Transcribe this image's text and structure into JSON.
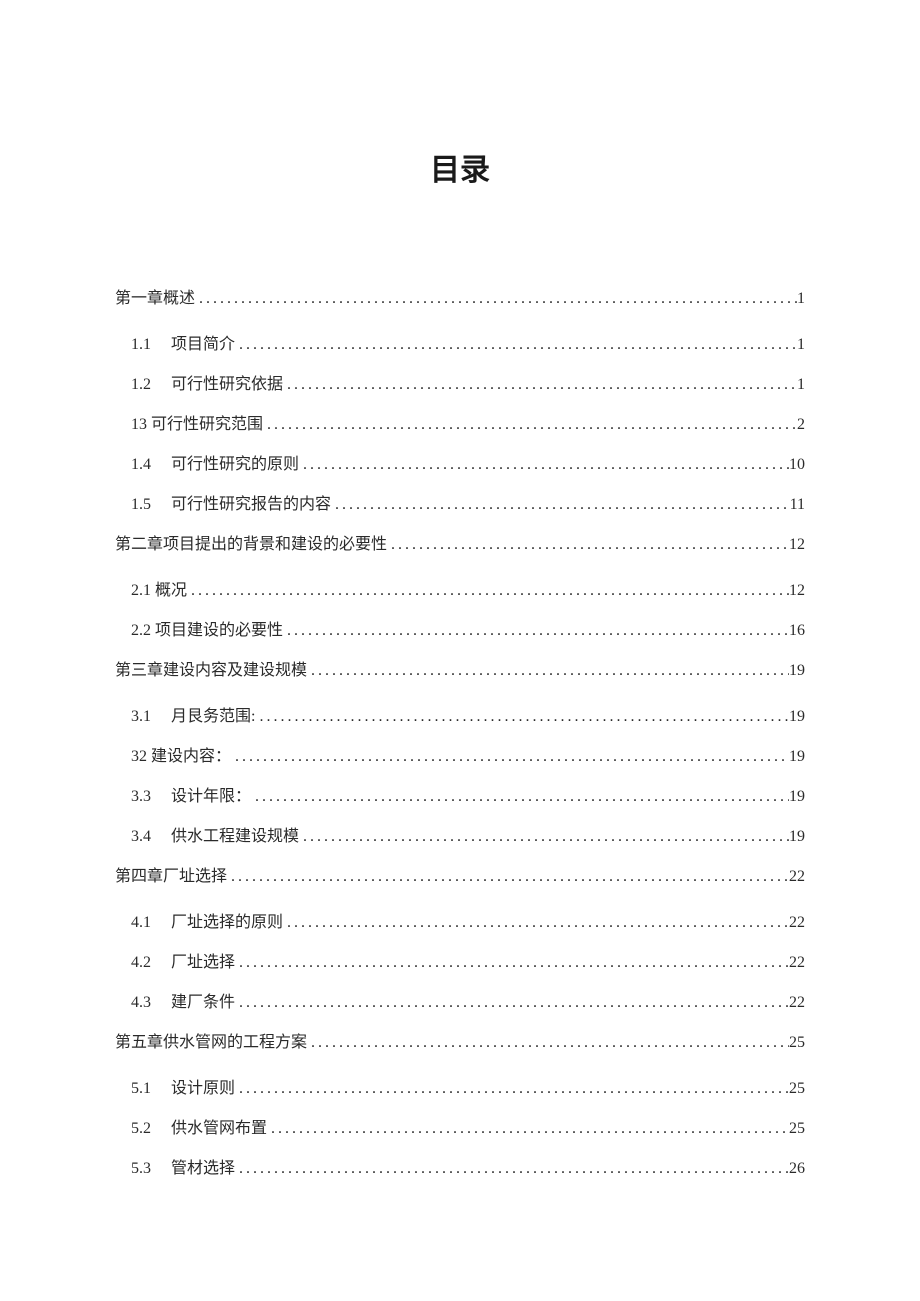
{
  "title": "目录",
  "entries": [
    {
      "indent": 0,
      "num": "",
      "label": "第一章概述",
      "page": "1"
    },
    {
      "indent": 1,
      "num": "1.1",
      "label": "项目简介",
      "page": "1"
    },
    {
      "indent": 1,
      "num": "1.2",
      "label": "可行性研究依据",
      "page": "1"
    },
    {
      "indent": 1,
      "num": "",
      "label": "13 可行性研究范围",
      "page": "2"
    },
    {
      "indent": 1,
      "num": "1.4",
      "label": "可行性研究的原则",
      "page": "10"
    },
    {
      "indent": 1,
      "num": "1.5",
      "label": "可行性研究报告的内容",
      "page": "11"
    },
    {
      "indent": 0,
      "num": "",
      "label": "第二章项目提出的背景和建设的必要性",
      "page": "12"
    },
    {
      "indent": 1,
      "num": "",
      "label": "2.1 概况",
      "page": "12"
    },
    {
      "indent": 1,
      "num": "",
      "label": "2.2 项目建设的必要性",
      "page": "16"
    },
    {
      "indent": 0,
      "num": "",
      "label": "第三章建设内容及建设规模",
      "page": "19"
    },
    {
      "indent": 1,
      "num": "3.1",
      "label": "月艮务范围:",
      "page": "19"
    },
    {
      "indent": 1,
      "num": "",
      "label": "32 建设内容：",
      "page": "19"
    },
    {
      "indent": 1,
      "num": "3.3",
      "label": "设计年限：",
      "page": "19"
    },
    {
      "indent": 1,
      "num": "3.4",
      "label": "供水工程建设规模",
      "page": "19"
    },
    {
      "indent": 0,
      "num": "",
      "label": "第四章厂址选择",
      "page": "22"
    },
    {
      "indent": 1,
      "num": "4.1",
      "label": "厂址选择的原则",
      "page": "22"
    },
    {
      "indent": 1,
      "num": "4.2",
      "label": "厂址选择",
      "page": "22"
    },
    {
      "indent": 1,
      "num": "4.3",
      "label": "建厂条件",
      "page": "22"
    },
    {
      "indent": 0,
      "num": "",
      "label": "第五章供水管网的工程方案",
      "page": "25"
    },
    {
      "indent": 1,
      "num": "5.1",
      "label": "设计原则",
      "page": "25"
    },
    {
      "indent": 1,
      "num": "5.2",
      "label": "供水管网布置",
      "page": "25"
    },
    {
      "indent": 1,
      "num": "5.3",
      "label": "管材选择",
      "page": "26"
    }
  ]
}
